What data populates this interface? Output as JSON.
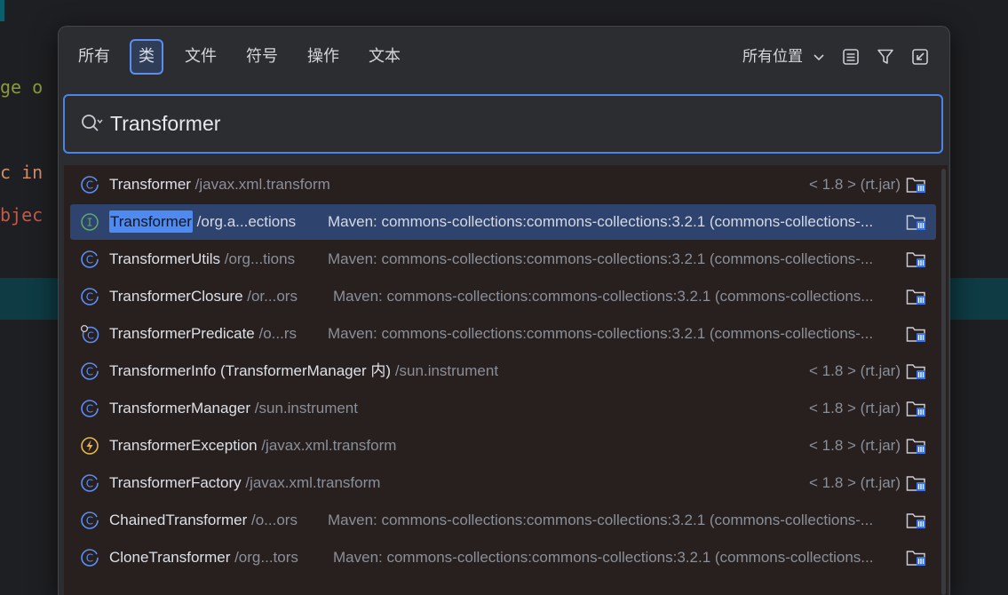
{
  "editor": {
    "line1": "ge o",
    "line2": "c in",
    "line3": "bjec"
  },
  "tabs": [
    {
      "label": "所有"
    },
    {
      "label": "类"
    },
    {
      "label": "文件"
    },
    {
      "label": "符号"
    },
    {
      "label": "操作"
    },
    {
      "label": "文本"
    }
  ],
  "scope": {
    "label": "所有位置"
  },
  "search": {
    "value": "Transformer"
  },
  "results": [
    {
      "match": "",
      "rest": "Transformer",
      "pkg": " /javax.xml.transform",
      "source": "< 1.8 > (rt.jar)",
      "icon": "class-icon"
    },
    {
      "match": "Transformer",
      "rest": "",
      "pkg": " /org.a...ections",
      "source": "Maven: commons-collections:commons-collections:3.2.1 (commons-collections-...",
      "icon": "interface-icon"
    },
    {
      "match": "",
      "rest": "TransformerUtils",
      "pkg": " /org...tions",
      "source": "Maven: commons-collections:commons-collections:3.2.1 (commons-collections-...",
      "icon": "class-icon"
    },
    {
      "match": "",
      "rest": "TransformerClosure",
      "pkg": " /or...ors",
      "source": "Maven: commons-collections:commons-collections:3.2.1 (commons-collections...",
      "icon": "class-icon"
    },
    {
      "match": "",
      "rest": "TransformerPredicate",
      "pkg": " /o...rs",
      "source": "Maven: commons-collections:commons-collections:3.2.1 (commons-collections-...",
      "icon": "class-link-icon"
    },
    {
      "match": "",
      "rest": "TransformerInfo (TransformerManager 内)",
      "pkg": " /sun.instrument",
      "source": "< 1.8 > (rt.jar)",
      "icon": "class-icon"
    },
    {
      "match": "",
      "rest": "TransformerManager",
      "pkg": " /sun.instrument",
      "source": "< 1.8 > (rt.jar)",
      "icon": "class-icon"
    },
    {
      "match": "",
      "rest": "TransformerException",
      "pkg": " /javax.xml.transform",
      "source": "< 1.8 > (rt.jar)",
      "icon": "exception-icon"
    },
    {
      "match": "",
      "rest": "TransformerFactory",
      "pkg": " /javax.xml.transform",
      "source": "< 1.8 > (rt.jar)",
      "icon": "class-icon"
    },
    {
      "match": "",
      "rest": "ChainedTransformer",
      "pkg": " /o...ors",
      "source": "Maven: commons-collections:commons-collections:3.2.1 (commons-collections-...",
      "icon": "class-icon"
    },
    {
      "match": "",
      "rest": "CloneTransformer",
      "pkg": " /org...tors",
      "source": "Maven: commons-collections:commons-collections:3.2.1 (commons-collections...",
      "icon": "class-icon"
    }
  ],
  "colors": {
    "accent": "#4f82e6",
    "selected_row": "#2e436e",
    "class_icon": "#5b8ef3",
    "interface_icon": "#62a66a",
    "exception_icon": "#e8b84a"
  }
}
